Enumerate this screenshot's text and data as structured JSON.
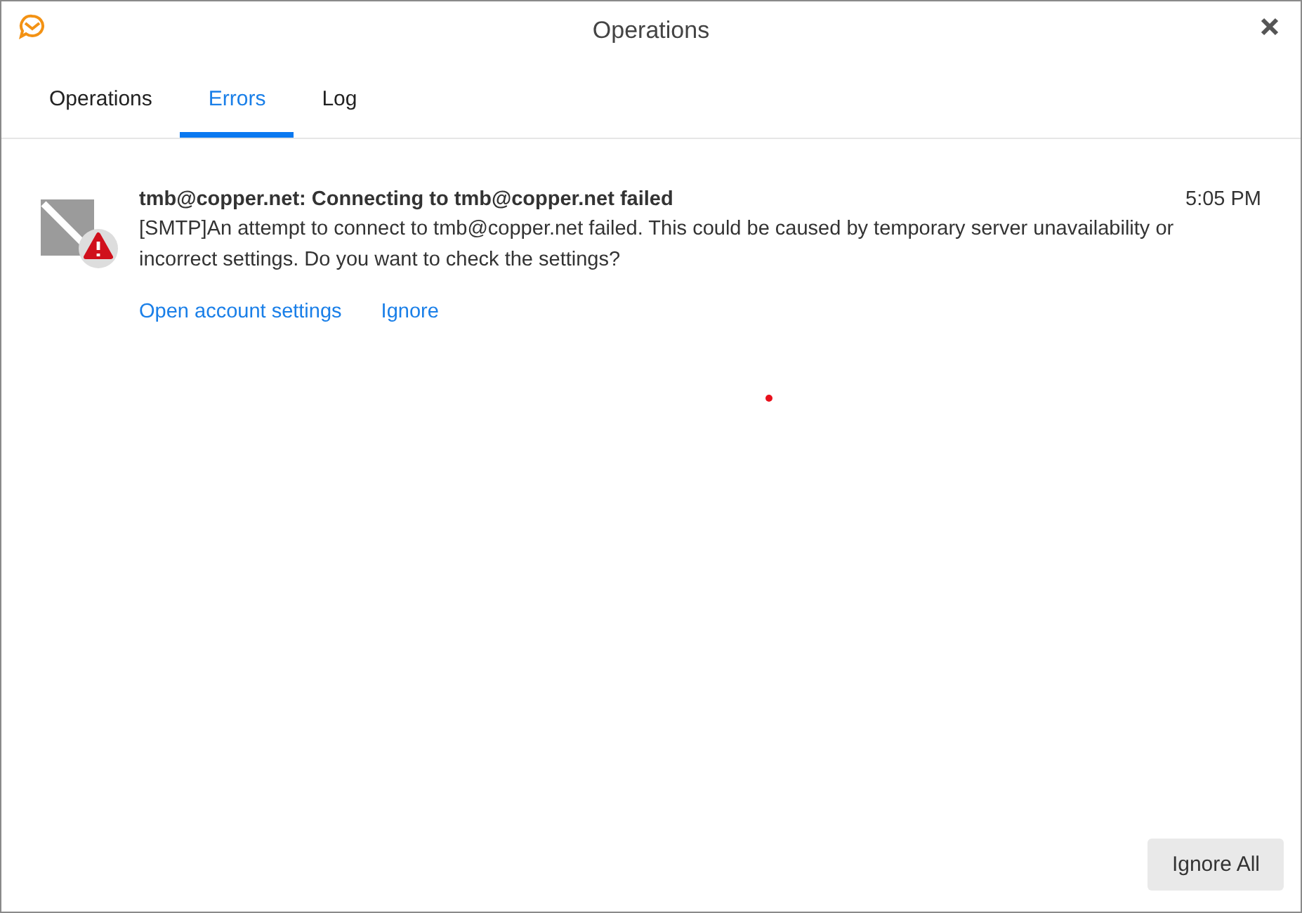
{
  "window": {
    "title": "Operations"
  },
  "tabs": [
    {
      "label": "Operations",
      "selected": false
    },
    {
      "label": "Errors",
      "selected": true
    },
    {
      "label": "Log",
      "selected": false
    }
  ],
  "errors": [
    {
      "title": "tmb@copper.net: Connecting to tmb@copper.net failed",
      "time": "5:05 PM",
      "message": "[SMTP]An attempt to connect to tmb@copper.net failed. This could be caused by temporary server unavailability or incorrect settings. Do you want to check the settings?",
      "actions": [
        "Open account settings",
        "Ignore"
      ]
    }
  ],
  "buttons": [
    "Ignore All"
  ]
}
